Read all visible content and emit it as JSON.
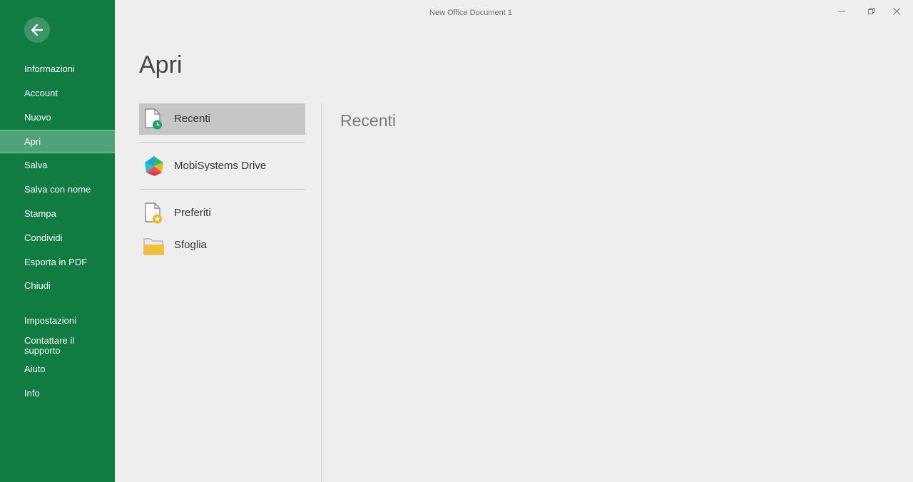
{
  "window": {
    "title": "New Office Document 1",
    "controls": [
      "minimize-icon",
      "restore-icon",
      "close-icon"
    ]
  },
  "sidebar": {
    "back_icon": "back-arrow-icon",
    "items": [
      {
        "label": "Informazioni"
      },
      {
        "label": "Account"
      },
      {
        "label": "Nuovo"
      },
      {
        "label": "Apri",
        "active": true
      },
      {
        "label": "Salva"
      },
      {
        "label": "Salva con nome"
      },
      {
        "label": "Stampa"
      },
      {
        "label": "Condividi"
      },
      {
        "label": "Esporta in PDF"
      },
      {
        "label": "Chiudi"
      },
      {
        "label": "Impostazioni"
      },
      {
        "label": "Contattare il supporto"
      },
      {
        "label": "Aiuto"
      },
      {
        "label": "Info"
      }
    ]
  },
  "main": {
    "title": "Apri",
    "places": [
      {
        "label": "Recenti",
        "icon": "recent-document-icon",
        "selected": true
      },
      {
        "label": "MobiSystems Drive",
        "icon": "mobisystems-drive-icon"
      },
      {
        "label": "Preferiti",
        "icon": "favorite-document-icon"
      },
      {
        "label": "Sfoglia",
        "icon": "folder-icon"
      }
    ],
    "panel_title": "Recenti"
  },
  "colors": {
    "sidebar": "#107c41",
    "sidebar_active": "#4fa37a",
    "background": "#eeeeee",
    "selected_place": "#c6c6c6",
    "folder": "#f2c232",
    "recent_badge": "#21a366",
    "favorite_badge": "#f2b61c"
  }
}
